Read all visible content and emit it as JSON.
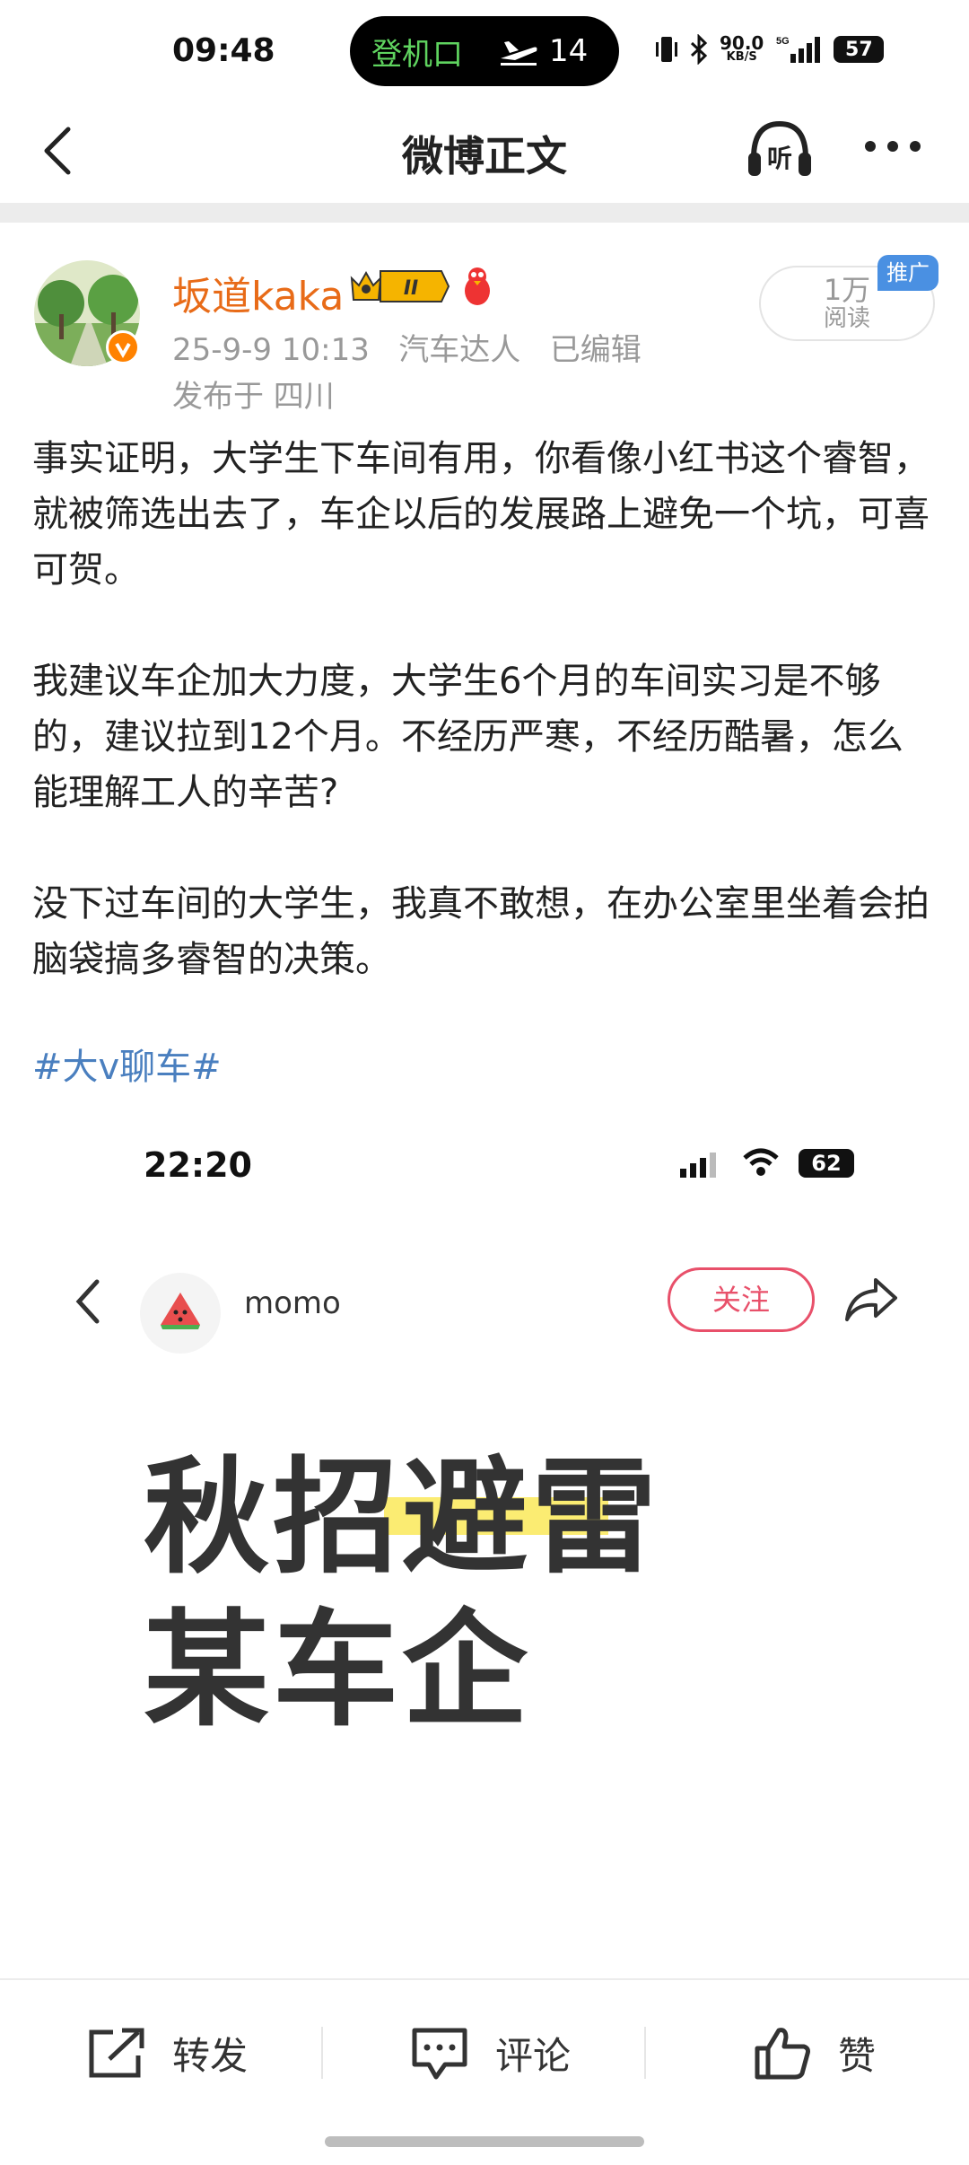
{
  "status_bar": {
    "time": "09:48",
    "island_label": "登机口",
    "island_number": "14",
    "net_speed_value": "90.0",
    "net_speed_unit": "KB/S",
    "network": "5G",
    "battery": "57"
  },
  "nav": {
    "title": "微博正文",
    "listen_label": "听"
  },
  "post": {
    "author": "坂道kaka",
    "rank_badge": "II",
    "meta": "25-9-9 10:13   汽车达人   已编辑",
    "location": "发布于 四川",
    "reads_count": "1万",
    "reads_label": "阅读",
    "promo_tag": "推广",
    "paragraphs": [
      "事实证明，大学生下车间有用，你看像小红书这个睿智，就被筛选出去了，车企以后的发展路上避免一个坑，可喜可贺。",
      "我建议车企加大力度，大学生6个月的车间实习是不够的，建议拉到12个月。不经历严寒，不经历酷暑，怎么能理解工人的辛苦?",
      "没下过车间的大学生，我真不敢想，在办公室里坐着会拍脑袋搞多睿智的决策。"
    ],
    "hashtag": "#大v聊车#"
  },
  "embedded": {
    "time": "22:20",
    "battery": "62",
    "user_name": "momo",
    "follow_label": "关注",
    "headline_line1": "秋招避雷",
    "headline_line2": "某车企"
  },
  "bottom_bar": {
    "repost": "转发",
    "comment": "评论",
    "like": "赞"
  },
  "colors": {
    "author_name": "#e86b18",
    "hashtag": "#4a7fbf",
    "follow": "#e8506a",
    "promo": "#4a90e2",
    "island_text": "#5fd35f"
  }
}
